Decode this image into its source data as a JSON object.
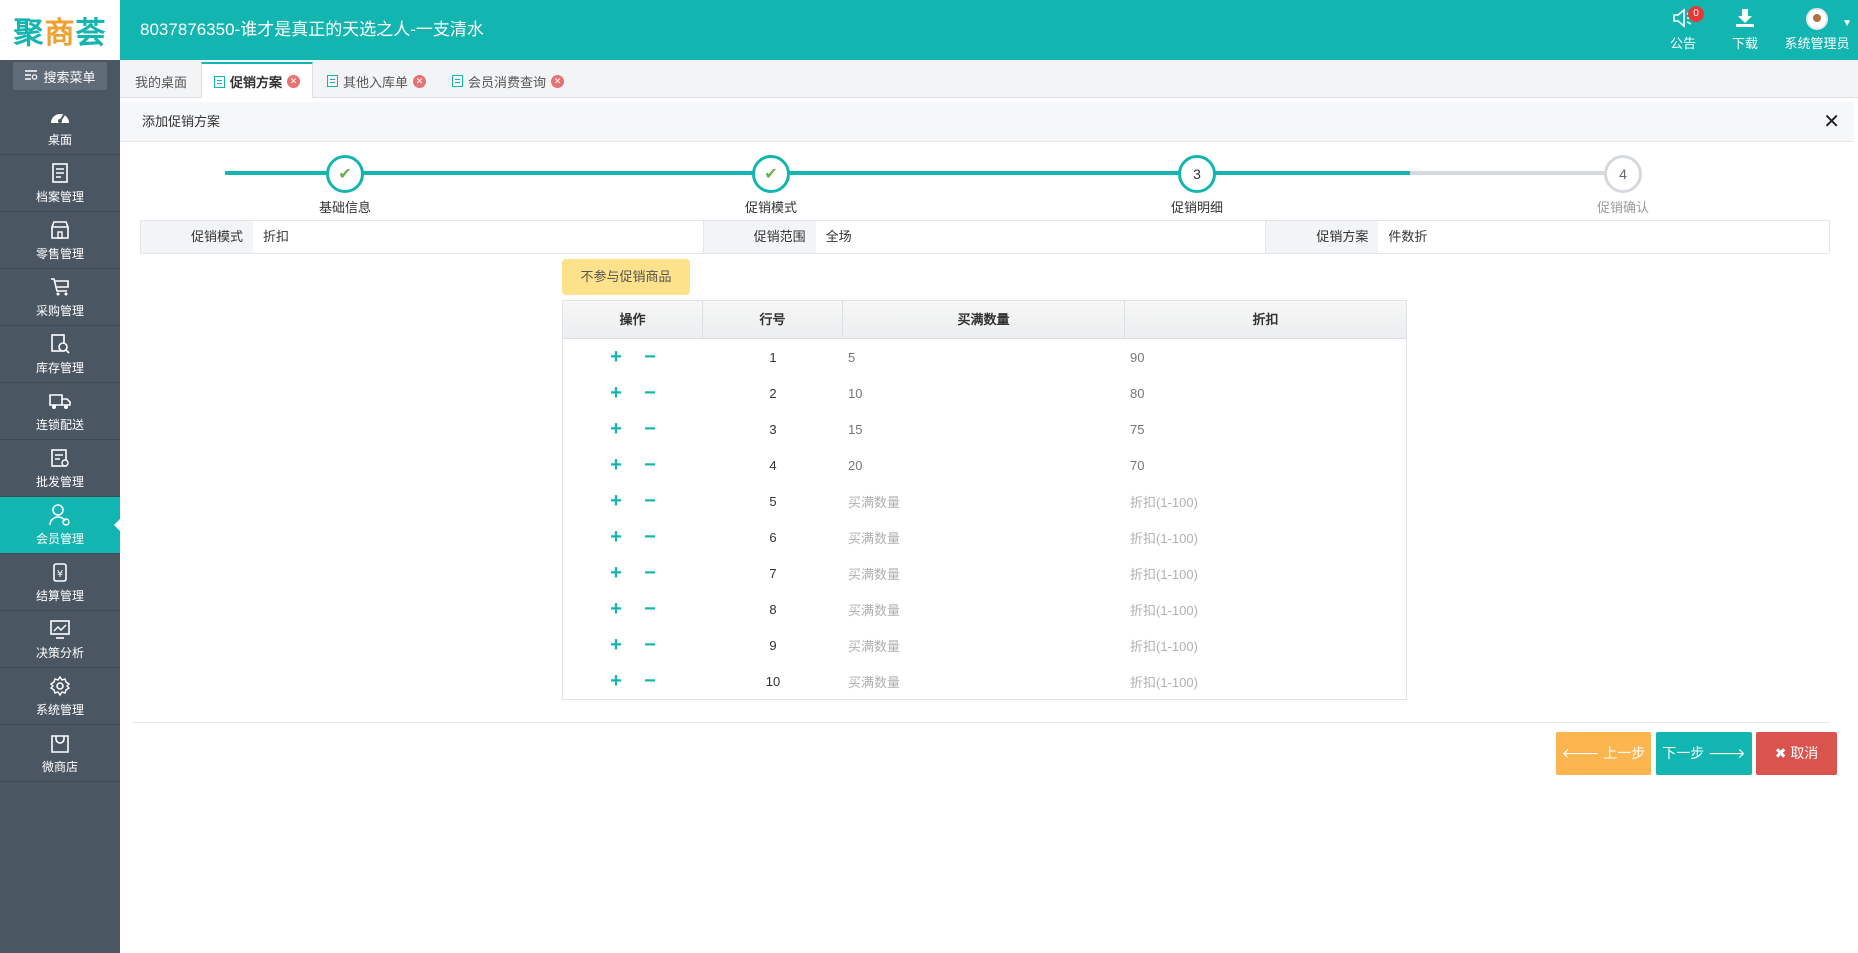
{
  "brand": {
    "logo_a": "聚",
    "logo_b": "商",
    "logo_c": "荟"
  },
  "header": {
    "company": "8037876350-谁才是真正的天选之人-一支清水",
    "notice_label": "公告",
    "notice_count": "0",
    "download_label": "下载",
    "user_label": "系统管理员"
  },
  "sidebar": {
    "search_label": "搜索菜单",
    "items": [
      {
        "label": "桌面",
        "icon": "dashboard-icon"
      },
      {
        "label": "档案管理",
        "icon": "archive-icon"
      },
      {
        "label": "零售管理",
        "icon": "store-icon"
      },
      {
        "label": "采购管理",
        "icon": "cart-icon"
      },
      {
        "label": "库存管理",
        "icon": "inventory-icon"
      },
      {
        "label": "连锁配送",
        "icon": "truck-icon"
      },
      {
        "label": "批发管理",
        "icon": "wholesale-icon"
      },
      {
        "label": "会员管理",
        "icon": "member-icon",
        "active": true
      },
      {
        "label": "结算管理",
        "icon": "settlement-icon"
      },
      {
        "label": "决策分析",
        "icon": "analysis-icon"
      },
      {
        "label": "系统管理",
        "icon": "gear-icon"
      },
      {
        "label": "微商店",
        "icon": "shop-bag-icon"
      }
    ]
  },
  "tabs": [
    {
      "label": "我的桌面"
    },
    {
      "label": "促销方案",
      "active": true
    },
    {
      "label": "其他入库单"
    },
    {
      "label": "会员消费查询"
    }
  ],
  "panel": {
    "title": "添加促销方案"
  },
  "steps": [
    {
      "label": "基础信息",
      "state": "done"
    },
    {
      "label": "促销模式",
      "state": "done"
    },
    {
      "label": "促销明细",
      "state": "current",
      "num": "3"
    },
    {
      "label": "促销确认",
      "state": "todo",
      "num": "4"
    }
  ],
  "info": {
    "mode_label": "促销模式",
    "mode_value": "折扣",
    "scope_label": "促销范围",
    "scope_value": "全场",
    "plan_label": "促销方案",
    "plan_value": "件数折"
  },
  "exclude_button": "不参与促销商品",
  "table": {
    "headers": [
      "操作",
      "行号",
      "买满数量",
      "折扣"
    ],
    "qty_placeholder": "买满数量",
    "disc_placeholder": "折扣(1-100)",
    "rows": [
      {
        "no": "1",
        "qty": "5",
        "disc": "90"
      },
      {
        "no": "2",
        "qty": "10",
        "disc": "80"
      },
      {
        "no": "3",
        "qty": "15",
        "disc": "75"
      },
      {
        "no": "4",
        "qty": "20",
        "disc": "70"
      },
      {
        "no": "5",
        "qty": "",
        "disc": ""
      },
      {
        "no": "6",
        "qty": "",
        "disc": ""
      },
      {
        "no": "7",
        "qty": "",
        "disc": ""
      },
      {
        "no": "8",
        "qty": "",
        "disc": ""
      },
      {
        "no": "9",
        "qty": "",
        "disc": ""
      },
      {
        "no": "10",
        "qty": "",
        "disc": ""
      }
    ]
  },
  "footer": {
    "prev": "上一步",
    "next": "下一步",
    "cancel": "取消"
  },
  "colors": {
    "accent": "#13b5b1",
    "sidebar": "#4b5663",
    "warning": "#fdb54f",
    "danger": "#d9534f"
  }
}
